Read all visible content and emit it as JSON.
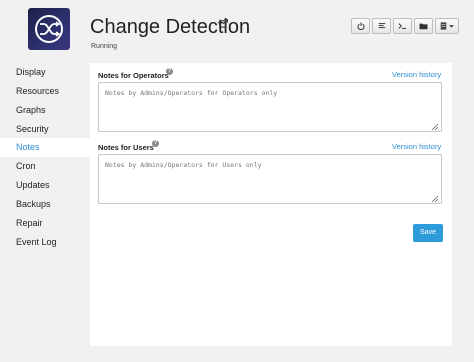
{
  "header": {
    "title": "Change Detection",
    "status": "Running"
  },
  "toolbar": {
    "buttons": [
      {
        "icon": "power-icon"
      },
      {
        "icon": "log-icon"
      },
      {
        "icon": "terminal-icon"
      },
      {
        "icon": "folder-icon"
      },
      {
        "icon": "storage-menu-icon"
      }
    ]
  },
  "sidebar": {
    "items": [
      {
        "label": "Display"
      },
      {
        "label": "Resources"
      },
      {
        "label": "Graphs"
      },
      {
        "label": "Security"
      },
      {
        "label": "Notes",
        "active": true
      },
      {
        "label": "Cron"
      },
      {
        "label": "Updates"
      },
      {
        "label": "Backups"
      },
      {
        "label": "Repair"
      },
      {
        "label": "Event Log"
      }
    ]
  },
  "notes": {
    "operators": {
      "label": "Notes for Operators",
      "version_link": "Version history",
      "placeholder": "Notes by Admins/Operators for Operators only"
    },
    "users": {
      "label": "Notes for Users",
      "version_link": "Version history",
      "placeholder": "Notes by Admins/Operators for Users only"
    },
    "save_label": "Save"
  },
  "colors": {
    "accent": "#2f8ed5",
    "save_button": "#2d9ad9",
    "app_icon_bg": "#2d2f6e"
  }
}
